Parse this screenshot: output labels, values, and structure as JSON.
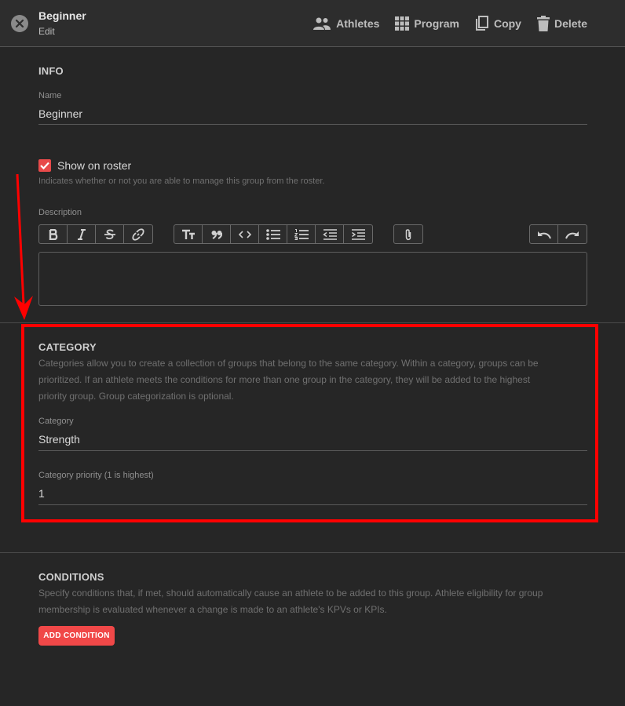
{
  "header": {
    "title": "Beginner",
    "subtitle": "Edit",
    "actions": [
      {
        "label": "Athletes",
        "icon": "people-icon"
      },
      {
        "label": "Program",
        "icon": "grid-icon"
      },
      {
        "label": "Copy",
        "icon": "copy-icon"
      },
      {
        "label": "Delete",
        "icon": "trash-icon"
      }
    ]
  },
  "info": {
    "heading": "INFO",
    "name_label": "Name",
    "name_value": "Beginner",
    "roster_label": "Show on roster",
    "roster_checked": true,
    "roster_helper": "Indicates whether or not you are able to manage this group from the roster.",
    "description_label": "Description",
    "description_value": ""
  },
  "toolbar": {
    "format": [
      "bold-icon",
      "italic-icon",
      "strikethrough-icon",
      "link-icon"
    ],
    "blocks": [
      "heading-icon",
      "quote-icon",
      "code-icon",
      "bullet-list-icon",
      "numbered-list-icon",
      "outdent-icon",
      "indent-icon"
    ],
    "attach": [
      "attachment-icon"
    ],
    "history": [
      "undo-icon",
      "redo-icon"
    ]
  },
  "category": {
    "heading": "CATEGORY",
    "helper_lines": [
      "Categories allow you to create a collection of groups that belong to the same category. Within a category, groups can be",
      "prioritized. If an athlete meets the conditions for more than one group in the category, they will be added to the highest",
      "priority group. Group categorization is optional."
    ],
    "category_label": "Category",
    "category_value": "Strength",
    "priority_label": "Category priority (1 is highest)",
    "priority_value": "1"
  },
  "conditions": {
    "heading": "CONDITIONS",
    "helper_lines": [
      "Specify conditions that, if met, should automatically cause an athlete to be added to this group. Athlete eligibility for group",
      "membership is evaluated whenever a change is made to an athlete's KPVs or KPIs."
    ],
    "add_label": "ADD CONDITION"
  },
  "colors": {
    "accent": "#f04848",
    "annotation": "#ff0000",
    "background": "#262626"
  }
}
